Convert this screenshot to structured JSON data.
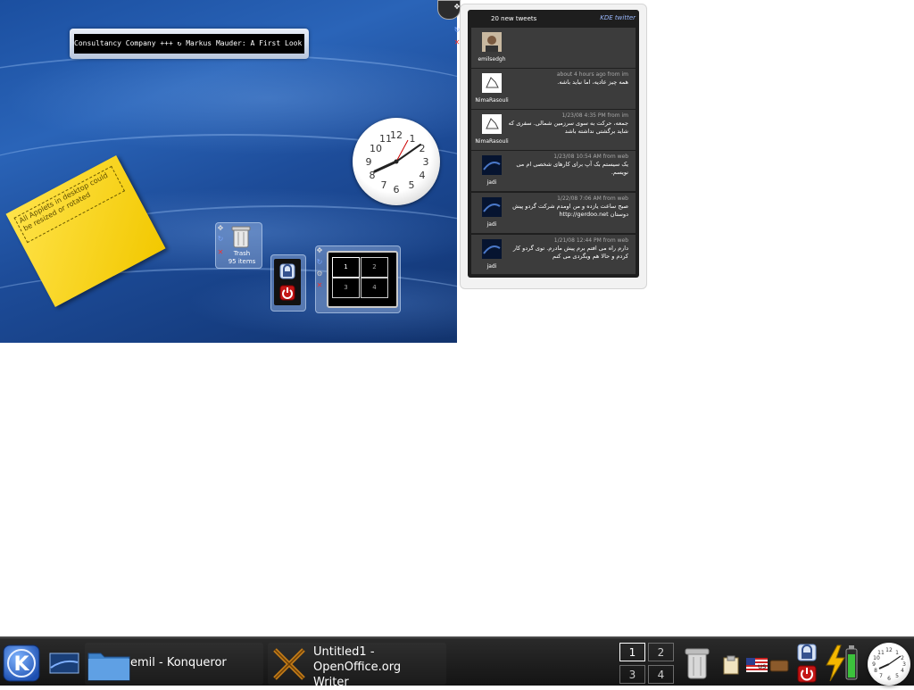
{
  "ticker": {
    "text": "Consultancy Company +++ ↻ Markus Mauder: A First Look at the Un"
  },
  "sticky_note": {
    "text": "All Applets in desktop could be resized or rotated"
  },
  "trash": {
    "label": "Trash",
    "count": "95 items"
  },
  "desktop_pager": {
    "cells": [
      "1",
      "2",
      "3",
      "4"
    ],
    "active": "1"
  },
  "twitter": {
    "header": "20 new tweets",
    "logo": "KDE twitter",
    "tweets": [
      {
        "user": "emilsedgh",
        "meta": "",
        "text": ""
      },
      {
        "user": "NimaRasouli",
        "meta": "about 4 hours ago from im",
        "text": "همه چیز عادیه، اما نباید باشه."
      },
      {
        "user": "NimaRasouli",
        "meta": "1/23/08 4:35 PM from im",
        "text": "جمعه، حرکت به سوی سرزمین شمالی. سفری که شاید برگشتی نداشته باشد"
      },
      {
        "user": "jadi",
        "meta": "1/23/08 10:54 AM from web",
        "text": "یک سیستم بک آپ برای کارهای شخصی ام می نویسم."
      },
      {
        "user": "jadi",
        "meta": "1/22/08 7:06 AM from web",
        "text": "صبح ساعت یازده و من اومدم شرکت گردو پیش دوستان http://gerdoo.net"
      },
      {
        "user": "jadi",
        "meta": "1/21/08 12:44 PM from web",
        "text": "دارم راه می افتم برم پیش مادرم. توی گردو کار کردم و حالا هم وبگردی می کنم"
      }
    ]
  },
  "taskbar": {
    "tasks": [
      {
        "label": "emil - Konqueror"
      },
      {
        "label": "Untitled1 - OpenOffice.org Writer"
      }
    ],
    "pager": [
      "1",
      "2",
      "3",
      "4"
    ],
    "active_desktop": "1"
  },
  "colors": {
    "desktop_blue": "#1d4c99",
    "note_yellow": "#f7d41c",
    "panel_dark": "#1e1e1e",
    "taskbar": "#141414"
  }
}
